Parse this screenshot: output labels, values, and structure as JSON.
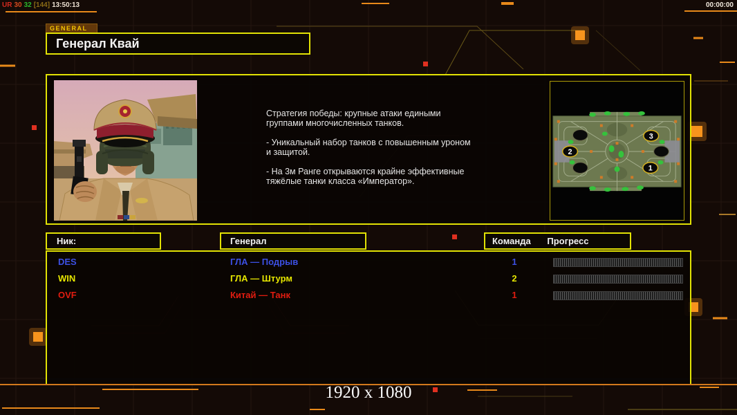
{
  "status_bar": {
    "debug": {
      "tag": "UR",
      "val1": "30",
      "val2": "32",
      "bracket": "[144]",
      "time": "13:50:13"
    },
    "clock": "00:00:00"
  },
  "header": {
    "tab_label": "GENERAL",
    "title": "Генерал Квай"
  },
  "general_info": {
    "description_paragraphs": [
      "Стратегия победы: крупные атаки едиными\n группами многочисленных танков.",
      "- Уникальный набор танков с повышенным уроном\n и защитой.",
      "- На 3м Ранге открываются крайне эффективные\n тяжёлые танки класса «Император»."
    ]
  },
  "minimap": {
    "start_positions": [
      "1",
      "2",
      "3"
    ]
  },
  "table": {
    "headers": {
      "nick": "Ник:",
      "general": "Генерал",
      "team": "Команда",
      "progress": "Прогресс"
    },
    "players": [
      {
        "nick": "DES",
        "general": "ГЛА — Подрыв",
        "team": "1",
        "color": "#3c50e4"
      },
      {
        "nick": "WIN",
        "general": "ГЛА — Штурм",
        "team": "2",
        "color": "#e6e600"
      },
      {
        "nick": "OVF",
        "general": "Китай — Танк",
        "team": "1",
        "color": "#e01c10"
      }
    ]
  },
  "footer": {
    "resolution": "1920 x 1080"
  },
  "colors": {
    "panel_border": "#e2e204",
    "accent_orange": "#f7941d",
    "alert_red": "#e03020",
    "background": "#140a06"
  }
}
